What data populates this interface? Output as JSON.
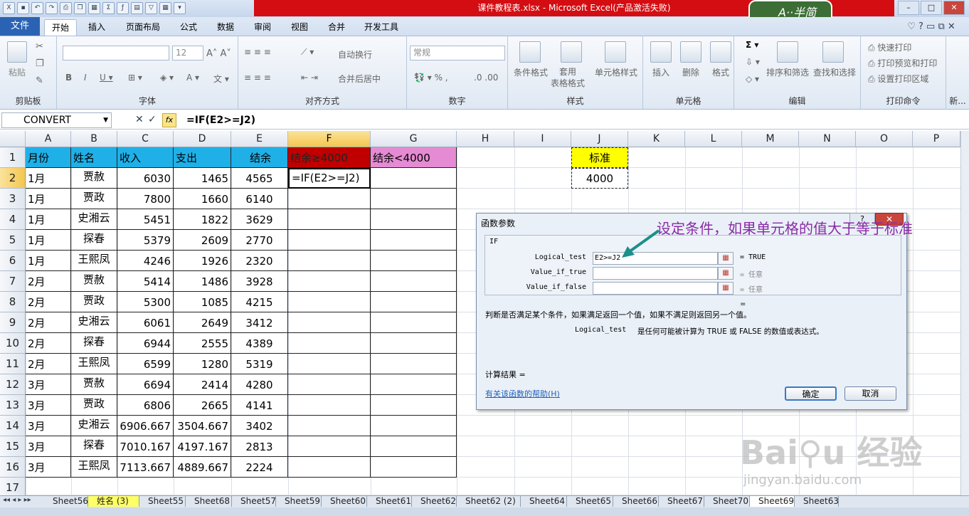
{
  "window": {
    "title": "课件教程表.xlsx - Microsoft Excel(产品激活失败)",
    "logo": "A··半简"
  },
  "ribbon": {
    "file_tab": "文件",
    "tabs": [
      "开始",
      "插入",
      "页面布局",
      "公式",
      "数据",
      "审阅",
      "视图",
      "合并",
      "开发工具"
    ],
    "clipboard": {
      "paste": "粘贴",
      "group": "剪贴板"
    },
    "font": {
      "size": "12",
      "group": "字体"
    },
    "align": {
      "wrap": "自动换行",
      "merge": "合并后居中",
      "group": "对齐方式"
    },
    "number": {
      "format": "常规",
      "group": "数字"
    },
    "styles": {
      "cond": "条件格式",
      "table": "套用\n表格格式",
      "cell": "单元格样式",
      "group": "样式"
    },
    "cells": {
      "insert": "插入",
      "delete": "删除",
      "format": "格式",
      "group": "单元格"
    },
    "edit": {
      "sort": "排序和筛选",
      "find": "查找和选择",
      "group": "编辑"
    },
    "print": {
      "quick": "快速打印",
      "preview": "打印预览和打印",
      "area": "设置打印区域",
      "group": "打印命令"
    },
    "extra_group": "新..."
  },
  "formula_bar": {
    "name_box": "CONVERT",
    "fx": "fx",
    "formula": "=IF(E2>=J2)"
  },
  "columns": [
    "A",
    "B",
    "C",
    "D",
    "E",
    "F",
    "G",
    "H",
    "I",
    "J",
    "K",
    "L",
    "M",
    "N",
    "O",
    "P"
  ],
  "rows": [
    "1",
    "2",
    "3",
    "4",
    "5",
    "6",
    "7",
    "8",
    "9",
    "10",
    "11",
    "12",
    "13",
    "14",
    "15",
    "16",
    "17"
  ],
  "headers": [
    "月份",
    "姓名",
    "收入",
    "支出",
    "结余",
    "结余≥4000",
    "结余<4000"
  ],
  "table": [
    [
      "1月",
      "贾赦",
      "6030",
      "1465",
      "4565",
      "=IF(E2>=J2)"
    ],
    [
      "1月",
      "贾政",
      "7800",
      "1660",
      "6140",
      ""
    ],
    [
      "1月",
      "史湘云",
      "5451",
      "1822",
      "3629",
      ""
    ],
    [
      "1月",
      "探春",
      "5379",
      "2609",
      "2770",
      ""
    ],
    [
      "1月",
      "王熙凤",
      "4246",
      "1926",
      "2320",
      ""
    ],
    [
      "2月",
      "贾赦",
      "5414",
      "1486",
      "3928",
      ""
    ],
    [
      "2月",
      "贾政",
      "5300",
      "1085",
      "4215",
      ""
    ],
    [
      "2月",
      "史湘云",
      "6061",
      "2649",
      "3412",
      ""
    ],
    [
      "2月",
      "探春",
      "6944",
      "2555",
      "4389",
      ""
    ],
    [
      "2月",
      "王熙凤",
      "6599",
      "1280",
      "5319",
      ""
    ],
    [
      "3月",
      "贾赦",
      "6694",
      "2414",
      "4280",
      ""
    ],
    [
      "3月",
      "贾政",
      "6806",
      "2665",
      "4141",
      ""
    ],
    [
      "3月",
      "史湘云",
      "6906.667",
      "3504.667",
      "3402",
      ""
    ],
    [
      "3月",
      "探春",
      "7010.167",
      "4197.167",
      "2813",
      ""
    ],
    [
      "3月",
      "王熙凤",
      "7113.667",
      "4889.667",
      "2224",
      ""
    ]
  ],
  "standard": {
    "label": "标准",
    "value": "4000"
  },
  "dialog": {
    "title": "函数参数",
    "fn": "IF",
    "args": [
      {
        "label": "Logical_test",
        "value": "E2>=J2",
        "result": "=  TRUE"
      },
      {
        "label": "Value_if_true",
        "value": "",
        "result": "=  任意"
      },
      {
        "label": "Value_if_false",
        "value": "",
        "result": "=  任意"
      }
    ],
    "eq": "=",
    "desc": "判断是否满足某个条件，如果满足返回一个值，如果不满足则返回另一个值。",
    "arg_name": "Logical_test",
    "arg_desc": "是任何可能被计算为 TRUE 或 FALSE 的数值或表达式。",
    "calc": "计算结果 =",
    "help": "有关该函数的帮助(H)",
    "ok": "确定",
    "cancel": "取消"
  },
  "annotation": "设定条件，如果单元格的值大于等于标准",
  "sheets": [
    "Sheet56",
    "姓名 (3)",
    "Sheet55",
    "Sheet68",
    "Sheet57",
    "Sheet59",
    "Sheet60",
    "Sheet61",
    "Sheet62",
    "Sheet62 (2)",
    "Sheet64",
    "Sheet65",
    "Sheet66",
    "Sheet67",
    "Sheet70",
    "Sheet69",
    "Sheet63"
  ],
  "watermark": {
    "brand": "Bai⚲u 经验",
    "url": "jingyan.baidu.com"
  },
  "colors": {
    "header_blue": "#1fb0e8",
    "header_red": "#c00000",
    "header_pink": "#e58bd3",
    "standard_yellow": "#ffff00",
    "accent": "#2b63b4"
  }
}
